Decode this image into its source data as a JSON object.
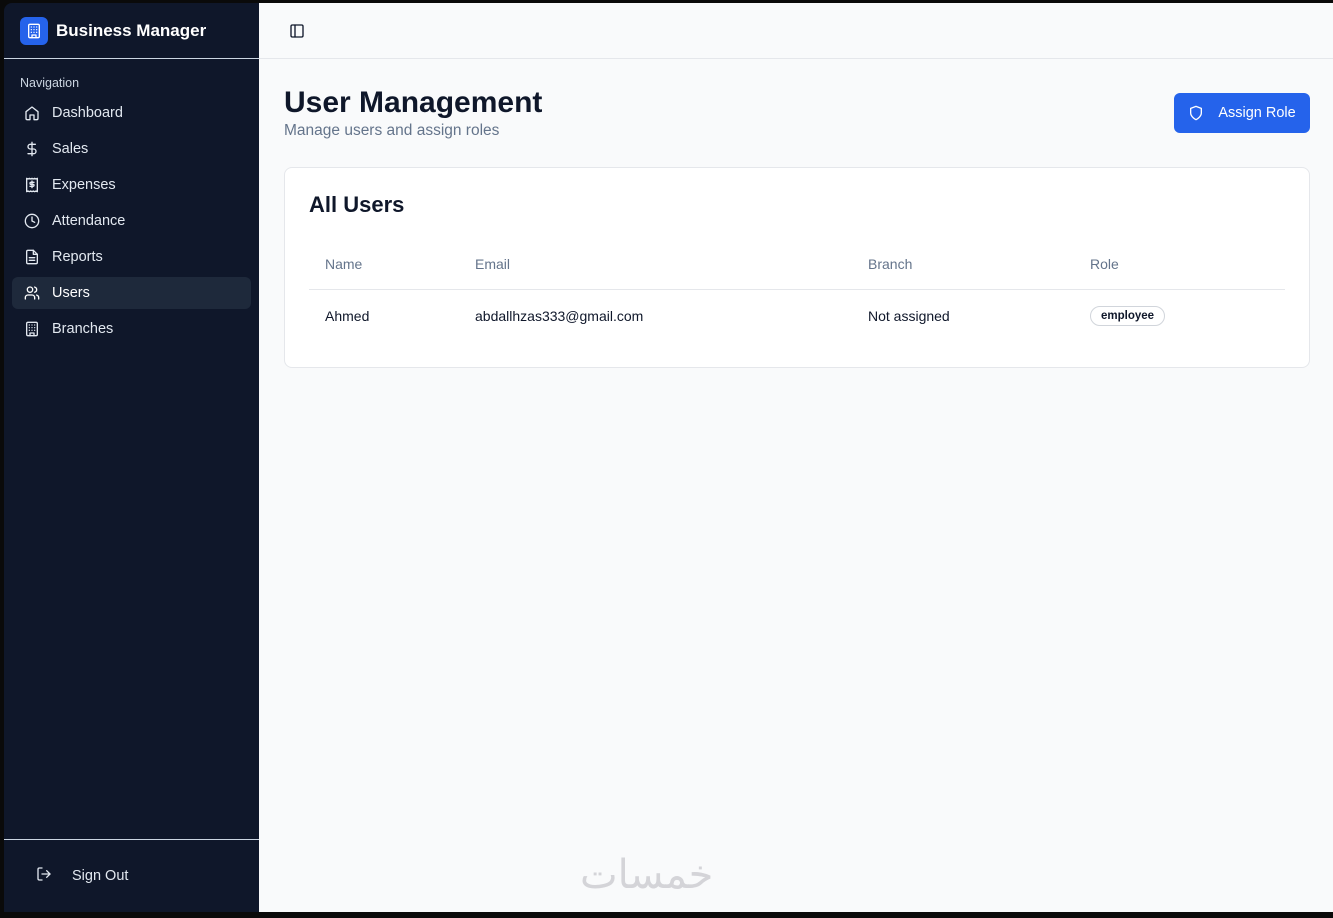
{
  "brand": {
    "name": "Business Manager",
    "icon": "building-icon",
    "color": "#2563eb"
  },
  "sidebar": {
    "group_label": "Navigation",
    "items": [
      {
        "label": "Dashboard",
        "icon": "home-icon"
      },
      {
        "label": "Sales",
        "icon": "dollar-icon"
      },
      {
        "label": "Expenses",
        "icon": "receipt-icon"
      },
      {
        "label": "Attendance",
        "icon": "clock-icon"
      },
      {
        "label": "Reports",
        "icon": "file-icon"
      },
      {
        "label": "Users",
        "icon": "users-icon",
        "active": true
      },
      {
        "label": "Branches",
        "icon": "building-icon"
      }
    ],
    "signout_label": "Sign Out"
  },
  "header": {
    "title": "User Management",
    "subtitle": "Manage users and assign roles",
    "assign_button": "Assign Role"
  },
  "table": {
    "title": "All Users",
    "columns": [
      "Name",
      "Email",
      "Branch",
      "Role"
    ],
    "rows": [
      {
        "name": "Ahmed",
        "email": "abdallhzas333@gmail.com",
        "branch": "Not assigned",
        "role": "employee"
      }
    ]
  },
  "watermark": "خمسات"
}
